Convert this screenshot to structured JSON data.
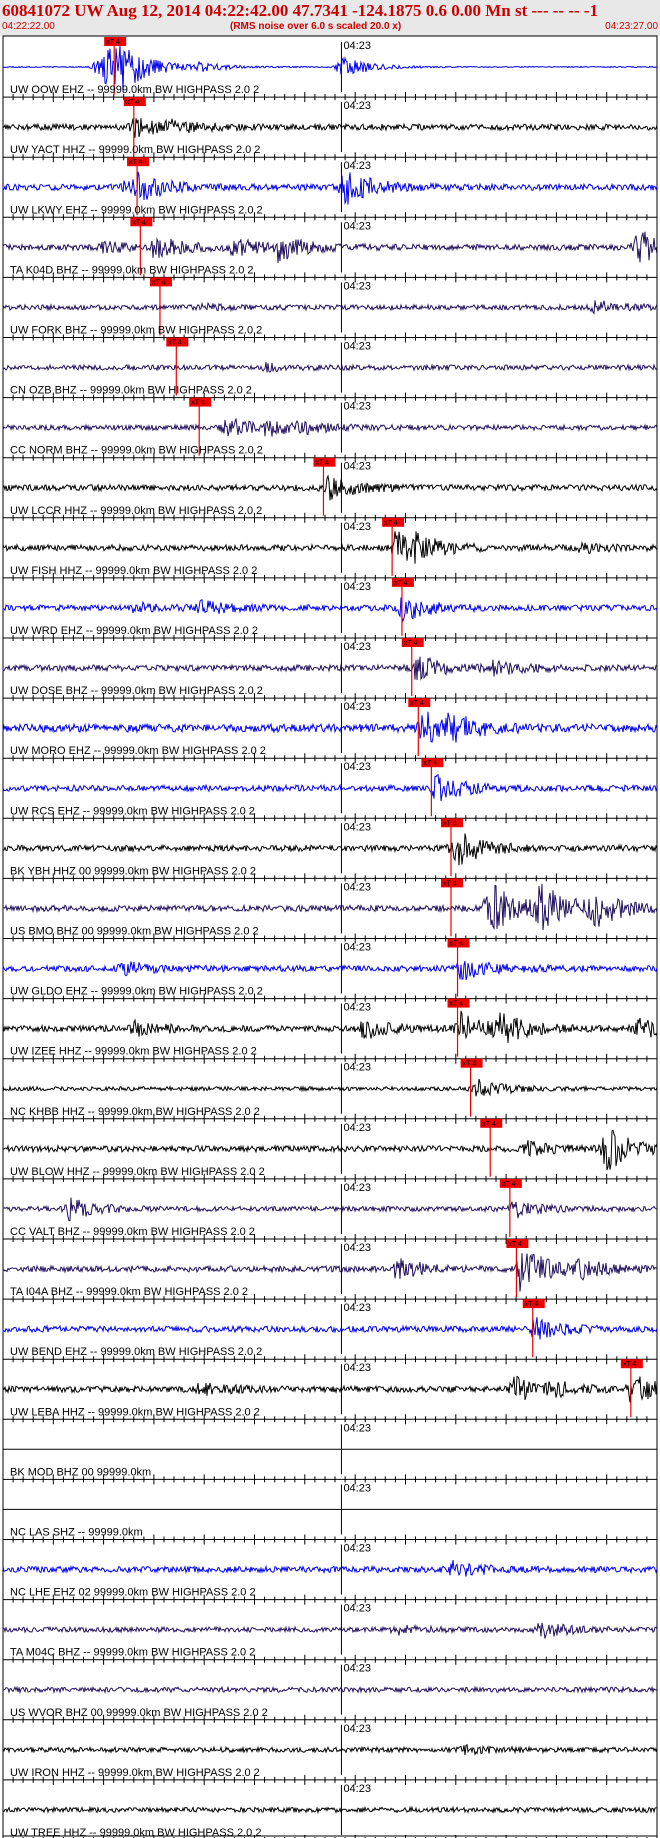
{
  "header": {
    "title": "60841072 UW Aug 12, 2014 04:22:42.00   47.7341 -124.1875  0.6 0.00 Mn st --- -- --   -1",
    "start_time": "04:22:22.00",
    "note": "(RMS noise over 6.0 s scaled 20.0 x)",
    "end_time": "04:23:27.00"
  },
  "colors": {
    "black": "#000000",
    "blue": "#0000ee",
    "purple": "#22115e",
    "pick": "#ee0000",
    "title": "#cc0000"
  },
  "minute_label": "04:23",
  "pick_label": "xT 4",
  "traces": [
    {
      "label": "UW OOW EHZ -- 99999.0km BW  HIGHPASS  2.0  2",
      "color": "blue",
      "amp": 0.5,
      "pick": 0.17,
      "events": [
        [
          0.17,
          25
        ],
        [
          0.155,
          14
        ],
        [
          0.14,
          6
        ],
        [
          0.515,
          12
        ],
        [
          0.3,
          4
        ]
      ],
      "seed": 1
    },
    {
      "label": "UW YACT HHZ -- 99999.0km BW  HIGHPASS  2.0  2",
      "color": "black",
      "amp": 3,
      "pick": 0.2,
      "events": [
        [
          0.2,
          9
        ],
        [
          0.25,
          5
        ]
      ],
      "seed": 2
    },
    {
      "label": "UW LKWY EHZ -- 99999.0km BW  HIGHPASS  2.0  2",
      "color": "blue",
      "amp": 3,
      "pick": 0.205,
      "events": [
        [
          0.205,
          12
        ],
        [
          0.52,
          18
        ],
        [
          0.18,
          4
        ]
      ],
      "seed": 3
    },
    {
      "label": "TA K04D BHZ -- 99999.0km BW  HIGHPASS  2.0  2",
      "color": "purple",
      "amp": 3,
      "pick": 0.21,
      "events": [
        [
          0.23,
          10
        ],
        [
          0.35,
          8
        ],
        [
          0.42,
          12
        ],
        [
          0.97,
          18
        ],
        [
          0.15,
          5
        ]
      ],
      "seed": 4
    },
    {
      "label": "UW FORK BHZ -- 99999.0km BW  HIGHPASS  2.0  2",
      "color": "purple",
      "amp": 2.5,
      "pick": 0.24,
      "events": [
        [
          0.905,
          6
        ],
        [
          0.3,
          3
        ]
      ],
      "seed": 5
    },
    {
      "label": "CN OZB BHZ -- 99999.0km BW  HIGHPASS  2.0  2",
      "color": "purple",
      "amp": 2.5,
      "pick": 0.265,
      "events": [
        [
          0.4,
          3
        ]
      ],
      "seed": 6
    },
    {
      "label": "CC NORM BHZ -- 99999.0km BW  HIGHPASS  2.0  2",
      "color": "purple",
      "amp": 2.5,
      "pick": 0.3,
      "events": [
        [
          0.34,
          10
        ],
        [
          0.4,
          7
        ],
        [
          0.45,
          5
        ]
      ],
      "seed": 7
    },
    {
      "label": "UW LCCR HHZ -- 99999.0km BW  HIGHPASS  2.0  2",
      "color": "black",
      "amp": 3,
      "pick": 0.49,
      "events": [
        [
          0.495,
          12
        ]
      ],
      "seed": 8
    },
    {
      "label": "UW FISH HHZ -- 99999.0km BW  HIGHPASS  2.0  2",
      "color": "black",
      "amp": 3,
      "pick": 0.595,
      "events": [
        [
          0.6,
          16
        ],
        [
          0.63,
          8
        ],
        [
          0.88,
          4
        ]
      ],
      "seed": 9
    },
    {
      "label": "UW WRD EHZ -- 99999.0km BW  HIGHPASS  2.0  2",
      "color": "blue",
      "amp": 3,
      "pick": 0.61,
      "events": [
        [
          0.61,
          12
        ],
        [
          0.3,
          6
        ],
        [
          0.2,
          4
        ]
      ],
      "seed": 10
    },
    {
      "label": "UW DOSE BHZ -- 99999.0km BW  HIGHPASS  2.0  2",
      "color": "purple",
      "amp": 3,
      "pick": 0.625,
      "events": [
        [
          0.63,
          12
        ],
        [
          0.75,
          6
        ]
      ],
      "seed": 11
    },
    {
      "label": "UW MORO EHZ -- 99999.0km BW  HIGHPASS  2.0  2",
      "color": "blue",
      "amp": 4,
      "pick": 0.635,
      "events": [
        [
          0.64,
          16
        ],
        [
          0.68,
          10
        ]
      ],
      "seed": 12
    },
    {
      "label": "UW RCS EHZ -- 99999.0km BW  HIGHPASS  2.0  2",
      "color": "blue",
      "amp": 3,
      "pick": 0.655,
      "events": [
        [
          0.66,
          14
        ]
      ],
      "seed": 13
    },
    {
      "label": "BK YBH HHZ 00 99999.0km BW  HIGHPASS  2.0  2",
      "color": "black",
      "amp": 3,
      "pick": 0.685,
      "events": [
        [
          0.69,
          18
        ]
      ],
      "seed": 14
    },
    {
      "label": "US BMO BHZ 00 99999.0km BW  HIGHPASS  2.0  2",
      "color": "purple",
      "amp": 3,
      "pick": 0.685,
      "events": [
        [
          0.74,
          28
        ],
        [
          0.82,
          24
        ],
        [
          0.9,
          18
        ]
      ],
      "seed": 15
    },
    {
      "label": "UW GLDO EHZ -- 99999.0km BW  HIGHPASS  2.0  2",
      "color": "blue",
      "amp": 3,
      "pick": 0.695,
      "events": [
        [
          0.7,
          12
        ],
        [
          0.18,
          6
        ]
      ],
      "seed": 16
    },
    {
      "label": "UW IZEE HHZ -- 99999.0km BW  HIGHPASS  2.0  2",
      "color": "black",
      "amp": 3,
      "pick": 0.695,
      "events": [
        [
          0.7,
          16
        ],
        [
          0.55,
          10
        ],
        [
          0.76,
          12
        ],
        [
          0.2,
          8
        ],
        [
          0.97,
          10
        ]
      ],
      "seed": 17
    },
    {
      "label": "NC KHBB HHZ -- 99999.0km BW  HIGHPASS  2.0  2",
      "color": "black",
      "amp": 2,
      "pick": 0.715,
      "events": [
        [
          0.72,
          10
        ]
      ],
      "seed": 18
    },
    {
      "label": "UW BLOW HHZ -- 99999.0km BW  HIGHPASS  2.0  2",
      "color": "black",
      "amp": 3,
      "pick": 0.745,
      "events": [
        [
          0.92,
          22
        ],
        [
          0.8,
          6
        ]
      ],
      "seed": 19
    },
    {
      "label": "CC VALT BHZ -- 99999.0km BW  HIGHPASS  2.0  2",
      "color": "purple",
      "amp": 2.5,
      "pick": 0.775,
      "events": [
        [
          0.1,
          10
        ],
        [
          0.78,
          8
        ]
      ],
      "seed": 20
    },
    {
      "label": "TA I04A BHZ -- 99999.0km BW  HIGHPASS  2.0  2",
      "color": "purple",
      "amp": 3,
      "pick": 0.785,
      "events": [
        [
          0.79,
          22
        ],
        [
          0.6,
          10
        ],
        [
          0.88,
          8
        ]
      ],
      "seed": 21
    },
    {
      "label": "UW BEND EHZ -- 99999.0km BW  HIGHPASS  2.0  2",
      "color": "blue",
      "amp": 3,
      "pick": 0.81,
      "events": [
        [
          0.81,
          12
        ]
      ],
      "seed": 22
    },
    {
      "label": "UW LEBA HHZ -- 99999.0km BW  HIGHPASS  2.0  2",
      "color": "black",
      "amp": 3,
      "pick": 0.96,
      "events": [
        [
          0.96,
          14
        ],
        [
          0.78,
          12
        ],
        [
          0.3,
          6
        ],
        [
          0.84,
          6
        ]
      ],
      "seed": 23
    },
    {
      "label": "BK MOD BHZ 00 99999.0km",
      "color": "black",
      "amp": 0,
      "pick": null,
      "events": [],
      "seed": 24
    },
    {
      "label": "NC LAS SHZ -- 99999.0km",
      "color": "black",
      "amp": 0,
      "pick": null,
      "events": [],
      "seed": 25
    },
    {
      "label": "NC LHE EHZ 02 99999.0km BW  HIGHPASS  2.0  2",
      "color": "blue",
      "amp": 3,
      "pick": null,
      "events": [
        [
          0.685,
          8
        ]
      ],
      "seed": 26
    },
    {
      "label": "TA M04C BHZ -- 99999.0km BW  HIGHPASS  2.0  2",
      "color": "purple",
      "amp": 2.5,
      "pick": null,
      "events": [
        [
          0.82,
          8
        ],
        [
          0.6,
          4
        ]
      ],
      "seed": 27
    },
    {
      "label": "US WVOR BHZ 00 99999.0km BW  HIGHPASS  2.0  2",
      "color": "purple",
      "amp": 2.5,
      "pick": null,
      "events": [],
      "seed": 28
    },
    {
      "label": "UW IRON HHZ -- 99999.0km BW  HIGHPASS  2.0  2",
      "color": "black",
      "amp": 2.5,
      "pick": null,
      "events": [
        [
          0.7,
          4
        ]
      ],
      "seed": 29
    },
    {
      "label": "UW TREE HHZ -- 99999.0km BW  HIGHPASS  2.0  2",
      "color": "black",
      "amp": 2.5,
      "pick": null,
      "events": [],
      "seed": 30
    }
  ]
}
